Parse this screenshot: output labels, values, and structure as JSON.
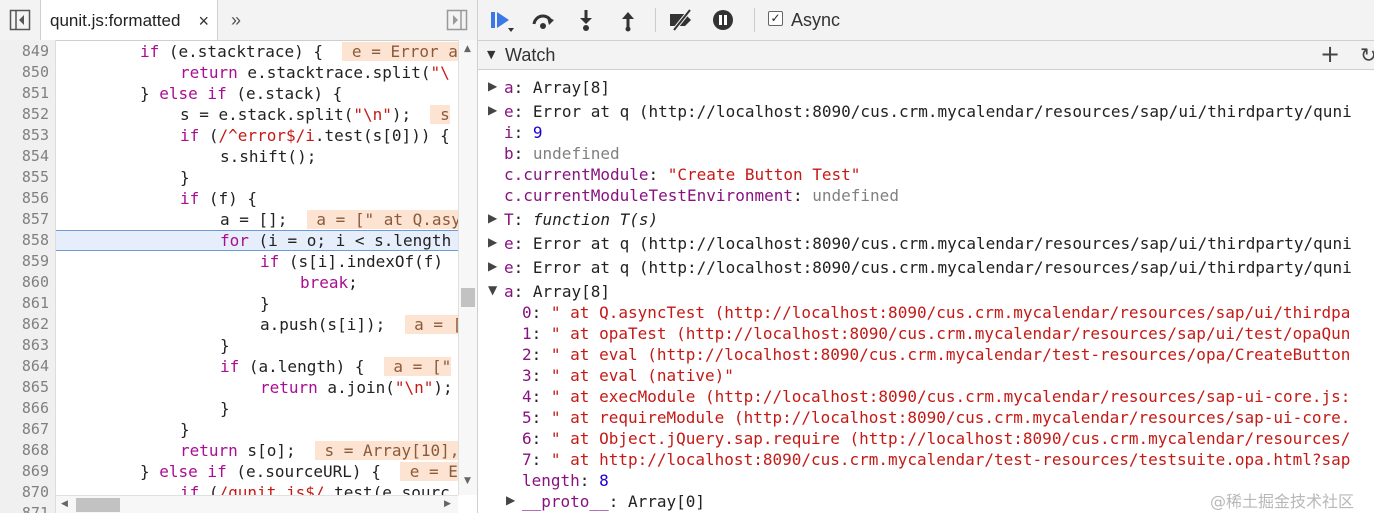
{
  "source_tab": {
    "label": "qunit.js:formatted",
    "close": "×",
    "more": "»"
  },
  "line_numbers": [
    "849",
    "850",
    "851",
    "852",
    "853",
    "854",
    "855",
    "856",
    "857",
    "858",
    "859",
    "860",
    "861",
    "862",
    "863",
    "864",
    "865",
    "866",
    "867",
    "868",
    "869",
    "870",
    "871"
  ],
  "code": {
    "l849": {
      "kw1": "if",
      "t1": " (e.stacktrace) {  ",
      "inline": " e = Error a"
    },
    "l850": {
      "kw1": "return",
      "t1": " e.stacktrace.split(",
      "str": "\"\\"
    },
    "l851": {
      "t0": "} ",
      "kw1": "else if",
      "t1": " (e.stack) {"
    },
    "l852": {
      "t1": "s = e.stack.split(",
      "str": "\"\\n\"",
      "t2": ");  ",
      "inline": " s"
    },
    "l853": {
      "kw1": "if",
      "t1": " (",
      "str": "/^error$/i",
      "t2": ".test(s[0])) {"
    },
    "l854": {
      "t1": "s.shift();"
    },
    "l855": {
      "t1": "}"
    },
    "l856": {
      "kw1": "if",
      "t1": " (f) {"
    },
    "l857": {
      "t1": "a = [];  ",
      "inline": " a = [\" at Q.asy"
    },
    "l858": {
      "kw1": "for",
      "t1": " (i = o; i < s.length"
    },
    "l859": {
      "kw1": "if",
      "t1": " (s[i].indexOf(f)"
    },
    "l860": {
      "kw1": "break",
      "t1": ";"
    },
    "l861": {
      "t1": "}"
    },
    "l862": {
      "t1": "a.push(s[i]);  ",
      "inline": " a = ["
    },
    "l863": {
      "t1": "}"
    },
    "l864": {
      "kw1": "if",
      "t1": " (a.length) {  ",
      "inline": " a = [\""
    },
    "l865": {
      "kw1": "return",
      "t1": " a.join(",
      "str": "\"\\n\"",
      "t2": ");"
    },
    "l866": {
      "t1": "}"
    },
    "l867": {
      "t1": "}"
    },
    "l868": {
      "kw1": "return",
      "t1": " s[o];  ",
      "inline": " s = Array[10],"
    },
    "l869": {
      "t0": "} ",
      "kw1": "else if",
      "t1": " (e.sourceURL) {  ",
      "inline": " e = E"
    },
    "l870": {
      "kw1": "if",
      "t1": " (",
      "str": "/qunit.js$/",
      "t2": ".test(e.sourc"
    }
  },
  "toolbar": {
    "async_label": "Async",
    "async_checked": "✓"
  },
  "watch": {
    "title": "Watch",
    "add": "+",
    "refresh": "↻",
    "rows": {
      "r1": {
        "name": "a",
        "value": " Array[8]"
      },
      "r2": {
        "name": "e",
        "value": " Error at q (http://localhost:8090/cus.crm.mycalendar/resources/sap/ui/thirdparty/quni"
      },
      "r3": {
        "name": "i",
        "value": "9"
      },
      "r4": {
        "name": "b",
        "value": "undefined"
      },
      "r5": {
        "name": "c.currentModule",
        "value": "\"Create Button Test\""
      },
      "r6": {
        "name": "c.currentModuleTestEnvironment",
        "value": "undefined"
      },
      "r7": {
        "name": "T",
        "value": "function T(s)"
      },
      "r8": {
        "name": "e",
        "value": " Error at q (http://localhost:8090/cus.crm.mycalendar/resources/sap/ui/thirdparty/quni"
      },
      "r9": {
        "name": "e",
        "value": " Error at q (http://localhost:8090/cus.crm.mycalendar/resources/sap/ui/thirdparty/quni"
      },
      "r10": {
        "name": "a",
        "value": " Array[8]"
      }
    },
    "array_items": {
      "i0": {
        "idx": "0",
        "value": "\" at Q.asyncTest (http://localhost:8090/cus.crm.mycalendar/resources/sap/ui/thirdpa"
      },
      "i1": {
        "idx": "1",
        "value": "\" at opaTest (http://localhost:8090/cus.crm.mycalendar/resources/sap/ui/test/opaQun"
      },
      "i2": {
        "idx": "2",
        "value": "\" at eval (http://localhost:8090/cus.crm.mycalendar/test-resources/opa/CreateButton"
      },
      "i3": {
        "idx": "3",
        "value": "\" at eval (native)\""
      },
      "i4": {
        "idx": "4",
        "value": "\" at execModule (http://localhost:8090/cus.crm.mycalendar/resources/sap-ui-core.js:"
      },
      "i5": {
        "idx": "5",
        "value": "\" at requireModule (http://localhost:8090/cus.crm.mycalendar/resources/sap-ui-core."
      },
      "i6": {
        "idx": "6",
        "value": "\" at Object.jQuery.sap.require (http://localhost:8090/cus.crm.mycalendar/resources/"
      },
      "i7": {
        "idx": "7",
        "value": "\" at http://localhost:8090/cus.crm.mycalendar/test-resources/testsuite.opa.html?sap"
      },
      "length": {
        "idx": "length",
        "value": "8"
      },
      "proto": {
        "idx": "__proto__",
        "value": "Array[0]"
      }
    }
  },
  "watermark": "@稀土掘金技术社区"
}
